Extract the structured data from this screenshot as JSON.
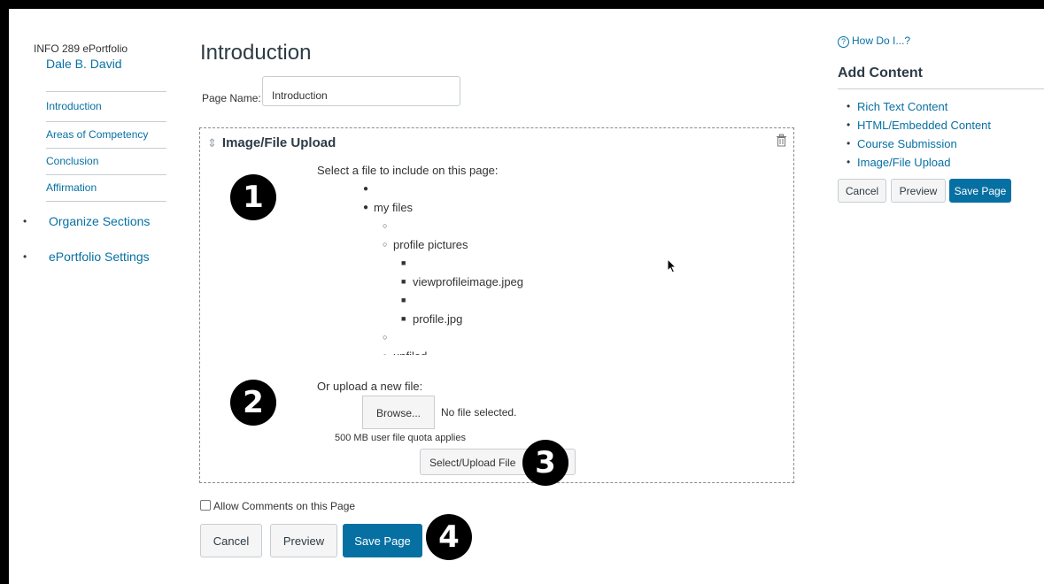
{
  "sidebar": {
    "course": "INFO 289 ePortfolio",
    "student": "Dale B. David",
    "pages": [
      "Introduction",
      "Areas of Competency",
      "Conclusion",
      "Affirmation"
    ],
    "links": [
      "Organize Sections",
      "ePortfolio Settings"
    ]
  },
  "page": {
    "title": "Introduction",
    "page_name_label": "Page Name:",
    "page_name_value": "Introduction"
  },
  "upload": {
    "heading": "Image/File Upload",
    "select_label": "Select a file to include on this page:",
    "tree": {
      "folder1": "my files",
      "folder2": "profile pictures",
      "file1": "viewprofileimage.jpeg",
      "file2": "profile.jpg",
      "folder3": "unfiled"
    },
    "or_label": "Or upload a new file:",
    "browse_label": "Browse...",
    "no_file": "No file selected.",
    "quota": "500 MB user file quota applies",
    "select_upload_label": "Select/Upload File"
  },
  "annotations": [
    "1",
    "2",
    "3",
    "4"
  ],
  "footer": {
    "allow_comments": "Allow Comments on this Page",
    "cancel": "Cancel",
    "preview": "Preview",
    "save": "Save Page"
  },
  "right": {
    "how_do_i": "How Do I...?",
    "add_content_title": "Add Content",
    "items": [
      "Rich Text Content",
      "HTML/Embedded Content",
      "Course Submission",
      "Image/File Upload"
    ],
    "cancel": "Cancel",
    "preview": "Preview",
    "save": "Save Page"
  },
  "colors": {
    "link": "#0770a3",
    "primary_button": "#0770a3",
    "text": "#2d3b45"
  }
}
